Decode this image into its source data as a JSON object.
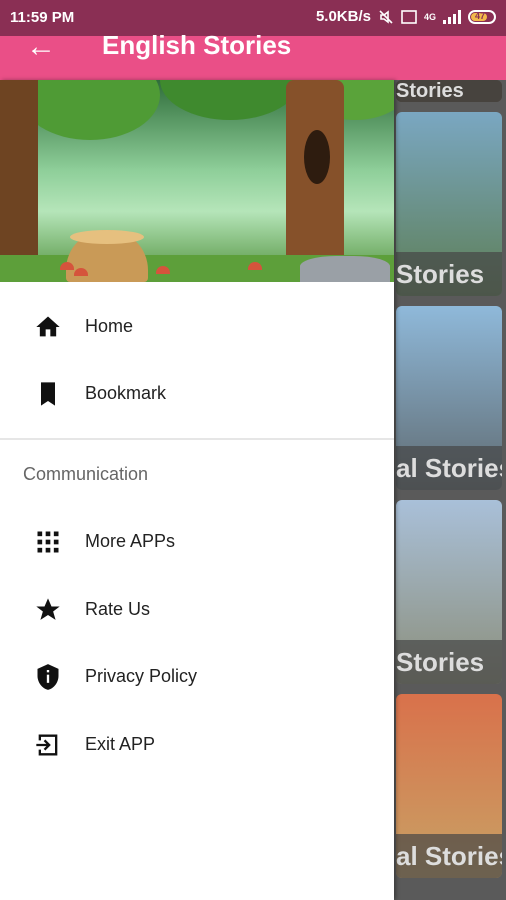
{
  "status_bar": {
    "time": "11:59 PM",
    "network_speed": "5.0KB/s",
    "network_type": "4G",
    "battery": "47"
  },
  "app_bar": {
    "title": "English Stories",
    "back_icon": "arrow-left-icon"
  },
  "background_cards": [
    {
      "caption": "Stories"
    },
    {
      "caption": "Stories"
    },
    {
      "caption": "al Stories"
    },
    {
      "caption": "Stories"
    },
    {
      "caption": "al Stories"
    }
  ],
  "drawer": {
    "menu": [
      {
        "label": "Home",
        "icon": "home-icon"
      },
      {
        "label": "Bookmark",
        "icon": "bookmark-icon"
      }
    ],
    "section_title": "Communication",
    "communication": [
      {
        "label": "More APPs",
        "icon": "grid-icon"
      },
      {
        "label": "Rate Us",
        "icon": "star-icon"
      },
      {
        "label": "Privacy Policy",
        "icon": "shield-info-icon"
      },
      {
        "label": "Exit APP",
        "icon": "exit-icon"
      }
    ]
  }
}
